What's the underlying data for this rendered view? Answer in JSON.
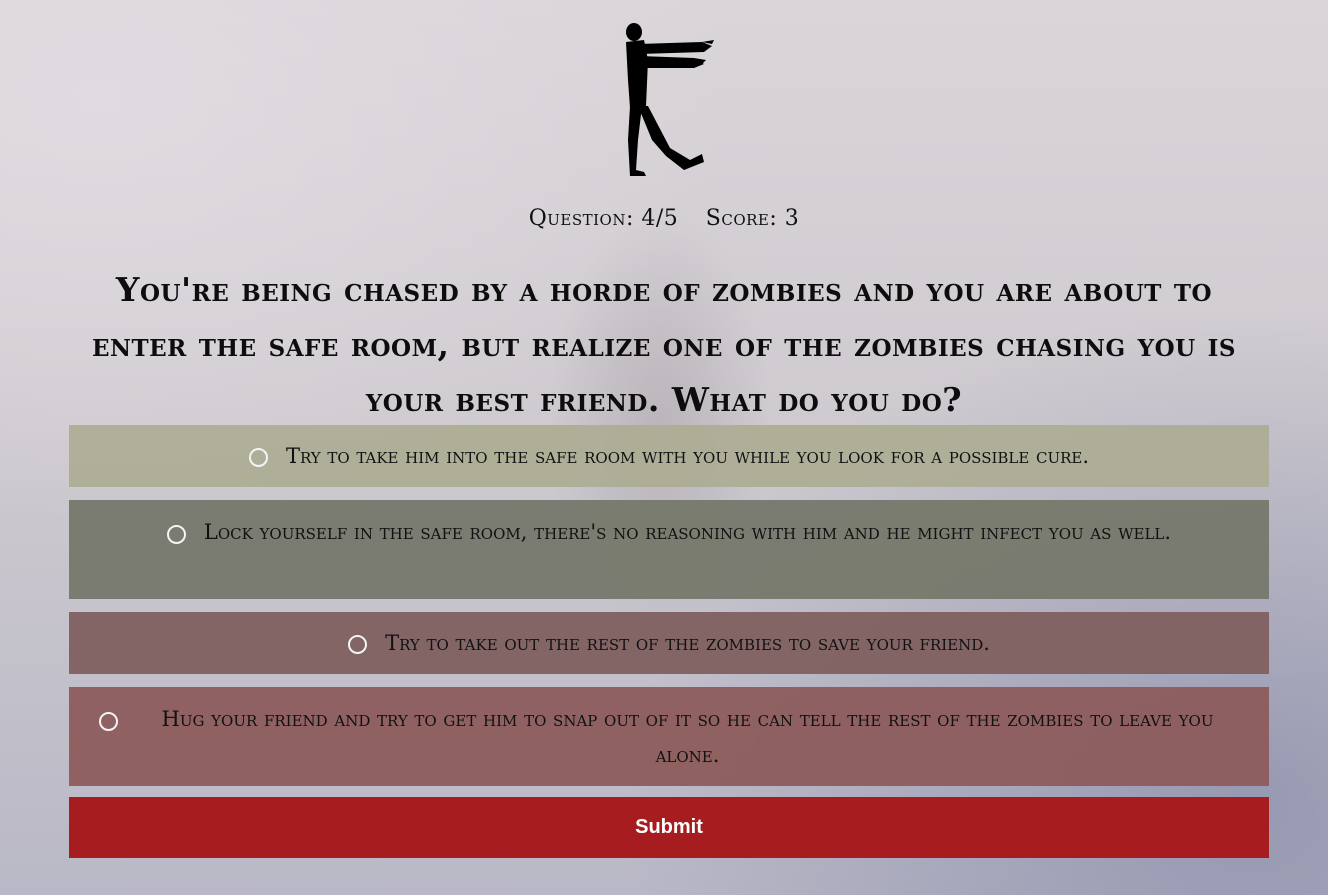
{
  "header": {
    "logo_icon": "zombie-silhouette-icon"
  },
  "stats": {
    "question_label": "Question: 4/5",
    "score_label": "Score: 3"
  },
  "question": {
    "text": "You're being chased by a horde of zombies and you are about to enter the safe room, but realize one of the zombies chasing you is your best friend. What do you do?"
  },
  "options": [
    {
      "label": "Try to take him into the safe room with you while you look for a possible cure.",
      "color": "#acac94"
    },
    {
      "label": "Lock yourself in the safe room, there's no reasoning with him and he might infect you as well.",
      "color": "#76786c"
    },
    {
      "label": "Try to take out the rest of the zombies to save your friend.",
      "color": "#806060"
    },
    {
      "label": "Hug your friend and try to get him to snap out of it so he can tell the rest of the zombies to leave you alone.",
      "color": "#8c5c5c"
    }
  ],
  "submit": {
    "label": "Submit",
    "color": "#a71c1f"
  }
}
